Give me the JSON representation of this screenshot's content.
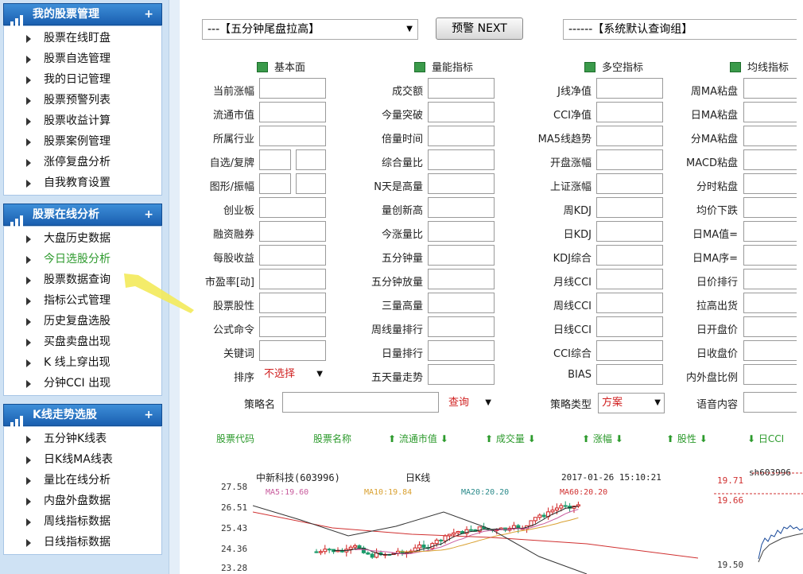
{
  "sidebar": {
    "groups": [
      {
        "title": "我的股票管理",
        "items": [
          "股票在线盯盘",
          "股票自选管理",
          "我的日记管理",
          "股票预警列表",
          "股票收益计算",
          "股票案例管理",
          "涨停复盘分析",
          "自我教育设置"
        ]
      },
      {
        "title": "股票在线分析",
        "items": [
          "大盘历史数据",
          "今日选股分析",
          "股票数据查询",
          "指标公式管理",
          "历史复盘选股",
          "买盘卖盘出现",
          "K 线上穿出现",
          "分钟CCI 出现"
        ],
        "active_index": 1
      },
      {
        "title": "K线走势选股",
        "items": [
          "五分钟K线表",
          "日K线MA线表",
          "量比在线分析",
          "内盘外盘数据",
          "周线指标数据",
          "日线指标数据"
        ]
      }
    ],
    "plus": "+"
  },
  "toolbar": {
    "strategy_select": "---【五分钟尾盘拉高】",
    "next_button": "预警 NEXT",
    "group_select": "------【系统默认查询组】"
  },
  "columns": {
    "col1": {
      "title": "基本面",
      "labels": [
        "当前涨幅",
        "流通市值",
        "所属行业",
        "自选/复牌",
        "图形/振幅",
        "创业板",
        "融资融券",
        "每股收益",
        "市盈率[动]",
        "股票股性",
        "公式命令",
        "关键词",
        "排序"
      ]
    },
    "col2": {
      "title": "量能指标",
      "labels": [
        "成交额",
        "今量突破",
        "倍量时间",
        "综合量比",
        "N天是高量",
        "量创新高",
        "今涨量比",
        "五分钟量",
        "五分钟放量",
        "三量高量",
        "周线量排行",
        "日量排行",
        "五天量走势"
      ]
    },
    "col3": {
      "title": "多空指标",
      "labels": [
        "J线净值",
        "CCI净值",
        "MA5线趋势",
        "开盘涨幅",
        "上证涨幅",
        "周KDJ",
        "日KDJ",
        "KDJ综合",
        "月线CCI",
        "周线CCI",
        "日线CCI",
        "CCI综合",
        "BIAS"
      ]
    },
    "col4": {
      "title": "均线指标",
      "labels": [
        "周MA粘盘",
        "日MA粘盘",
        "分MA粘盘",
        "MACD粘盘",
        "分时粘盘",
        "均价下跌",
        "日MA值=",
        "日MA序=",
        "日价排行",
        "拉高出货",
        "日开盘价",
        "日收盘价",
        "内外盘比例"
      ]
    }
  },
  "sort_select": "不选择",
  "bottom_row": {
    "strategy_name_label": "策略名",
    "query_select": "查询",
    "strategy_type_label": "策略类型",
    "strategy_type_value": "方案",
    "voice_label": "语音内容"
  },
  "grid_headers": [
    "股票代码",
    "股票名称",
    "流通市值",
    "成交量",
    "涨幅",
    "股性",
    "日CCI"
  ],
  "chart_data": {
    "type": "candlestick",
    "title": "中新科技(603996)",
    "period": "日K线",
    "timestamp": "2017-01-26 15:10:21",
    "yticks": [
      "27.58",
      "26.51",
      "25.43",
      "24.36",
      "23.28"
    ],
    "ma_labels": [
      {
        "text": "MA5:19.60",
        "color": "#c85a9c"
      },
      {
        "text": "MA10:19.84",
        "color": "#d9a030"
      },
      {
        "text": "MA20:20.20",
        "color": "#2a8a8a"
      },
      {
        "text": "MA60:20.20",
        "color": "#d03030"
      }
    ],
    "side": {
      "code": "sh603996",
      "p1": "19.71",
      "p2": "19.66",
      "p3": "19.50"
    }
  }
}
